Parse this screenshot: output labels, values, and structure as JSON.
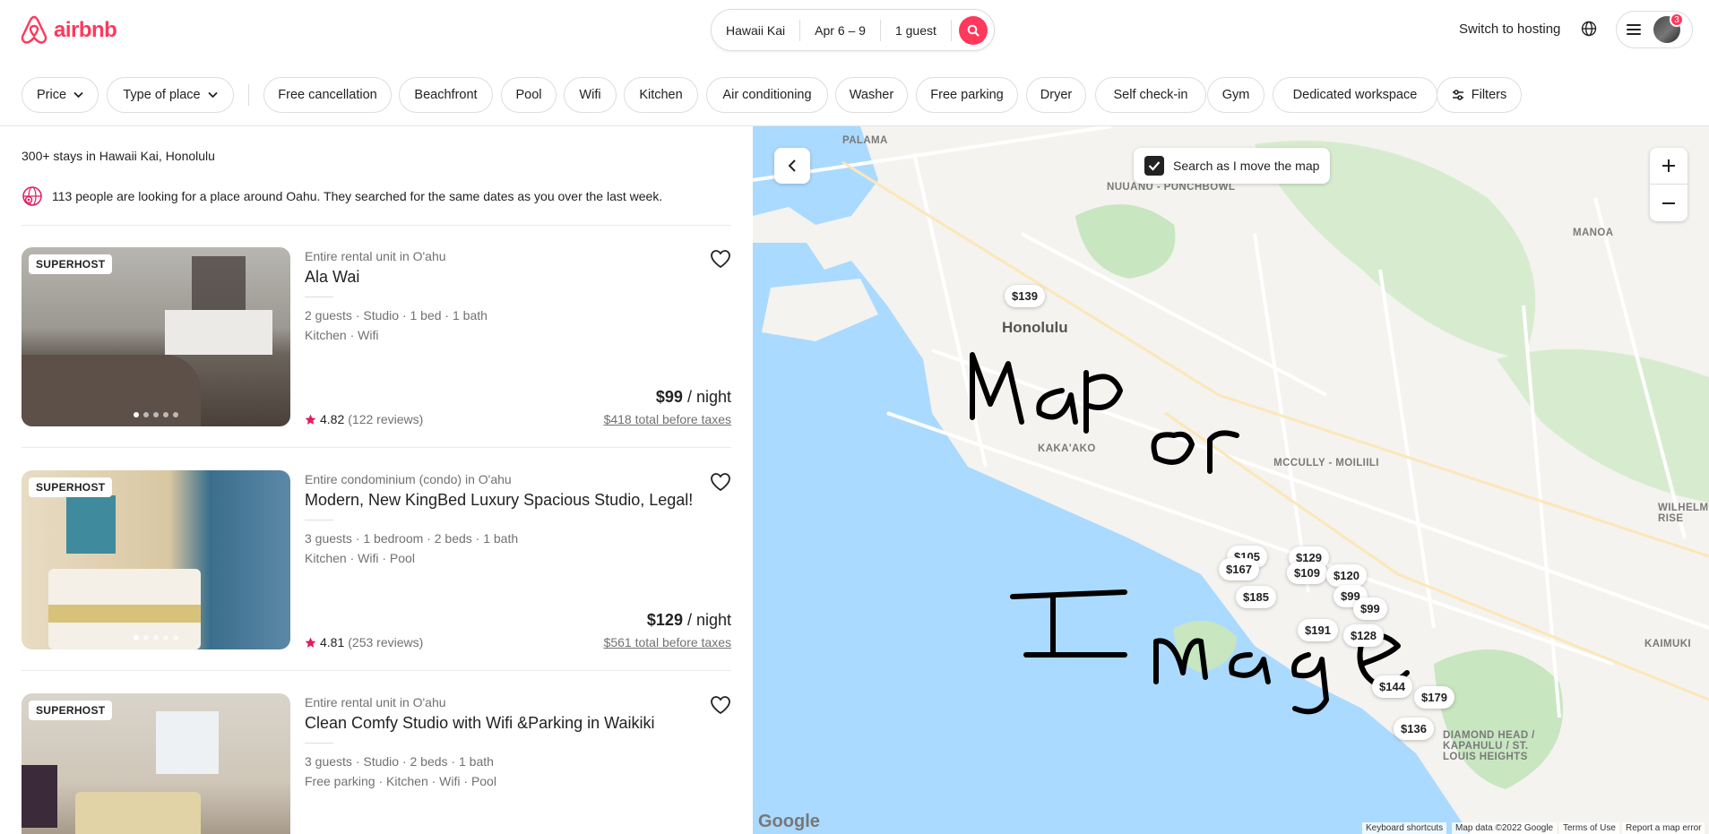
{
  "brand": {
    "name": "airbnb",
    "color": "#FF385C"
  },
  "search": {
    "location": "Hawaii Kai",
    "dates": "Apr 6 – 9",
    "guests": "1 guest"
  },
  "header": {
    "switch_host": "Switch to hosting",
    "notifications": "3"
  },
  "filters": {
    "price": "Price",
    "type_of_place": "Type of place",
    "chips": [
      "Free cancellation",
      "Beachfront",
      "Pool",
      "Wifi",
      "Kitchen",
      "Air conditioning",
      "Washer",
      "Free parking",
      "Dryer",
      "Self check-in",
      "Gym",
      "Dedicated workspace"
    ],
    "filters_button": "Filters"
  },
  "results": {
    "count": "300+ stays in Hawaii Kai, Honolulu",
    "notice": "113 people are looking for a place around Oahu. They searched for the same dates as you over the last week."
  },
  "listings": [
    {
      "badge": "SUPERHOST",
      "subtitle": "Entire rental unit in O'ahu",
      "title": "Ala Wai",
      "details": "2 guests · Studio · 1 bed · 1 bath",
      "amenities": "Kitchen · Wifi",
      "rating": "4.82",
      "reviews": "(122 reviews)",
      "price": "$99",
      "per": " / night",
      "total": "$418 total before taxes"
    },
    {
      "badge": "SUPERHOST",
      "subtitle": "Entire condominium (condo) in O'ahu",
      "title": "Modern, New KingBed Luxury Spacious Studio, Legal!",
      "details": "3 guests · 1 bedroom · 2 beds · 1 bath",
      "amenities": "Kitchen · Wifi · Pool",
      "rating": "4.81",
      "reviews": "(253 reviews)",
      "price": "$129",
      "per": " / night",
      "total": "$561 total before taxes"
    },
    {
      "badge": "SUPERHOST",
      "subtitle": "Entire rental unit in O'ahu",
      "title": "Clean Comfy Studio with Wifi &Parking in Waikiki",
      "details": "3 guests · Studio · 2 beds · 1 bath",
      "amenities": "Free parking · Kitchen · Wifi · Pool"
    }
  ],
  "map": {
    "search_toggle": "Search as I move the map",
    "labels": {
      "palama": "PALAMA",
      "nuuanu": "NUUANU - PUNCHBOWL",
      "manoa": "MANOA",
      "honolulu": "Honolulu",
      "kakaako": "KAKA'AKO",
      "moiliili": "MCCULLY - MOILIILI",
      "wilhelmina": "WILHELMINA RISE",
      "kaimuki": "KAIMUKI",
      "diamond": "DIAMOND HEAD / KAPAHULU / ST. LOUIS HEIGHTS"
    },
    "pins": [
      "$139",
      "$105",
      "$167",
      "$129",
      "$109",
      "$120",
      "$185",
      "$99",
      "$99",
      "$191",
      "$128",
      "$144",
      "$179",
      "$136"
    ],
    "google": "Google",
    "footer": {
      "shortcuts": "Keyboard shortcuts",
      "data": "Map data ©2022 Google",
      "terms": "Terms of Use",
      "report": "Report a map error"
    },
    "overlay": "Map or Image"
  }
}
